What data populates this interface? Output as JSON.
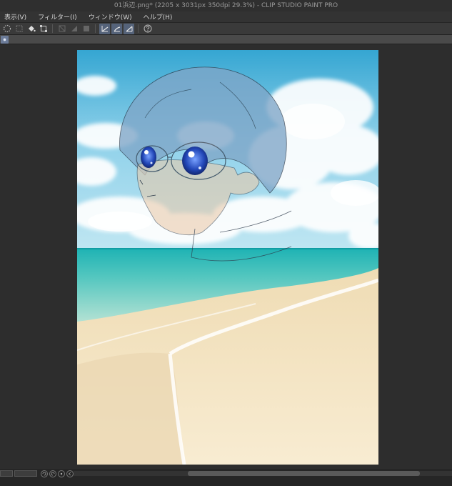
{
  "window": {
    "title": "01浜辺.png* (2205 x 3031px 350dpi 29.3%) - CLIP STUDIO PAINT PRO"
  },
  "menu": [
    {
      "label": "表示(V)"
    },
    {
      "label": "フィルター(I)"
    },
    {
      "label": "ウィンドウ(W)"
    },
    {
      "label": "ヘルプ(H)"
    }
  ],
  "toolbar": {
    "icons": [
      "selection-dashed-icon",
      "select-all-icon",
      "fill-bucket-icon",
      "transform-icon",
      "clear-icon",
      "fill-icon",
      "invert-icon",
      "stabilizer-1-icon",
      "stabilizer-2-icon",
      "stabilizer-3-icon",
      "help-icon"
    ]
  },
  "colors": {
    "accent": "#55637a",
    "ui_dark": "#2b2b2b"
  }
}
